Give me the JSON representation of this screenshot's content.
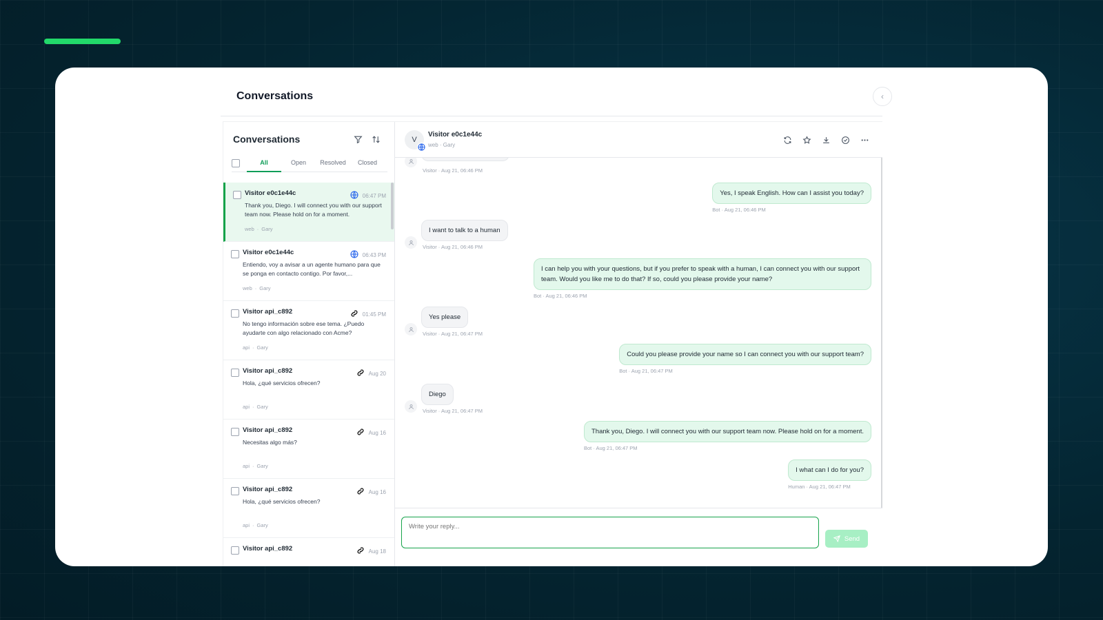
{
  "page": {
    "title": "Conversations"
  },
  "list": {
    "title": "Conversations",
    "tabs": [
      "All",
      "Open",
      "Resolved",
      "Closed"
    ],
    "active_tab": "All",
    "items": [
      {
        "name": "Visitor e0c1e44c",
        "time": "06:47 PM",
        "text": "Thank you, Diego. I will connect you with our support team now. Please hold on for a moment.",
        "channel": "web",
        "sep": "·",
        "agent": "Gary",
        "icon": "globe-icon",
        "selected": true
      },
      {
        "name": "Visitor e0c1e44c",
        "time": "06:43 PM",
        "text": "Entiendo, voy a avisar a un agente humano para que se ponga en contacto contigo. Por favor,...",
        "channel": "web",
        "sep": "·",
        "agent": "Gary",
        "icon": "globe-icon"
      },
      {
        "name": "Visitor api_c892",
        "time": "01:45 PM",
        "text": "No tengo información sobre ese tema. ¿Puedo ayudarte con algo relacionado con Acme?",
        "channel": "api",
        "sep": "·",
        "agent": "Gary",
        "icon": "link-icon"
      },
      {
        "name": "Visitor api_c892",
        "time": "Aug 20",
        "text": "Hola, ¿qué servicios ofrecen?",
        "channel": "api",
        "sep": "·",
        "agent": "Gary",
        "icon": "link-icon"
      },
      {
        "name": "Visitor api_c892",
        "time": "Aug 16",
        "text": "Necesitas algo más?",
        "channel": "api",
        "sep": "·",
        "agent": "Gary",
        "icon": "link-icon"
      },
      {
        "name": "Visitor api_c892",
        "time": "Aug 16",
        "text": "Hola, ¿qué servicios ofrecen?",
        "channel": "api",
        "sep": "·",
        "agent": "Gary",
        "icon": "link-icon"
      },
      {
        "name": "Visitor api_c892",
        "time": "Aug 18",
        "text": "",
        "channel": "",
        "sep": "",
        "agent": "",
        "icon": "link-icon"
      }
    ]
  },
  "chat": {
    "avatar": "V",
    "name": "Visitor e0c1e44c",
    "sub": "web · Gary",
    "messages": [
      {
        "role": "visitor",
        "text": "",
        "meta": "Visitor · Aug 21, 06:46 PM"
      },
      {
        "role": "bot",
        "text": "Yes, I speak English. How can I assist you today?",
        "meta": "Bot · Aug 21, 06:46 PM"
      },
      {
        "role": "visitor",
        "text": "I want to talk to a human",
        "meta": "Visitor · Aug 21, 06:46 PM"
      },
      {
        "role": "bot",
        "text": "I can help you with your questions, but if you prefer to speak with a human, I can connect you with our support team. Would you like me to do that? If so, could you please provide your name?",
        "meta": "Bot · Aug 21, 06:46 PM"
      },
      {
        "role": "visitor",
        "text": "Yes please",
        "meta": "Visitor · Aug 21, 06:47 PM"
      },
      {
        "role": "bot",
        "text": "Could you please provide your name so I can connect you with our support team?",
        "meta": "Bot · Aug 21, 06:47 PM"
      },
      {
        "role": "visitor",
        "text": "Diego",
        "meta": "Visitor · Aug 21, 06:47 PM"
      },
      {
        "role": "bot",
        "text": "Thank you, Diego. I will connect you with our support team now. Please hold on for a moment.",
        "meta": "Bot · Aug 21, 06:47 PM"
      },
      {
        "role": "human",
        "text": "I what can I do for you?",
        "meta": "Human · Aug 21, 06:47 PM"
      }
    ]
  },
  "composer": {
    "placeholder": "Write your reply...",
    "send_label": "Send"
  },
  "colors": {
    "accent": "#16a34a",
    "bot_bubble": "#e3f8ec",
    "visitor_bubble": "#f3f4f6",
    "background": "#042430",
    "bar": "#22d96a"
  }
}
